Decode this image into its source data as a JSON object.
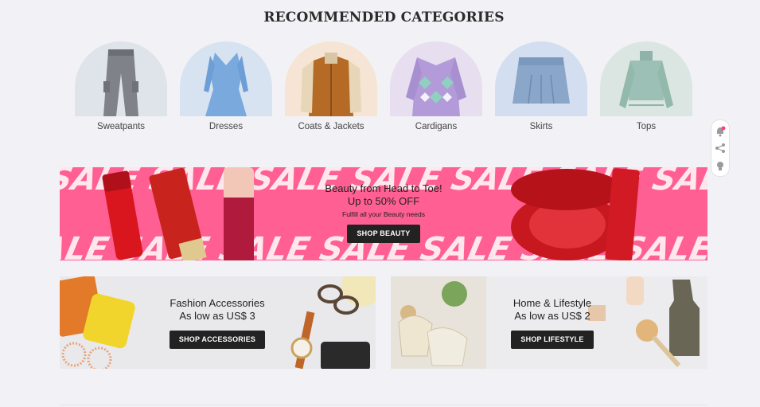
{
  "section": {
    "title": "RECOMMENDED CATEGORIES"
  },
  "categories": [
    {
      "label": "Sweatpants"
    },
    {
      "label": "Dresses"
    },
    {
      "label": "Coats & Jackets"
    },
    {
      "label": "Cardigans"
    },
    {
      "label": "Skirts"
    },
    {
      "label": "Tops"
    }
  ],
  "floating_toolbar": {
    "icons": [
      "bell-icon",
      "share-icon",
      "lightbulb-icon"
    ]
  },
  "banners": {
    "beauty": {
      "headline_1": "Beauty from Head to Toe!",
      "headline_2": "Up to 50% OFF",
      "subtext": "Fulfill all your Beauty needs",
      "button": "SHOP BEAUTY",
      "bg_word": "SALE",
      "bg_color": "#ff5f92"
    },
    "accessories": {
      "headline_1": "Fashion Accessories",
      "headline_2": "As low as US$ 3",
      "button": "SHOP ACCESSORIES"
    },
    "lifestyle": {
      "headline_1": "Home & Lifestyle",
      "headline_2": "As low as US$ 2",
      "button": "SHOP LIFESTYLE"
    }
  }
}
